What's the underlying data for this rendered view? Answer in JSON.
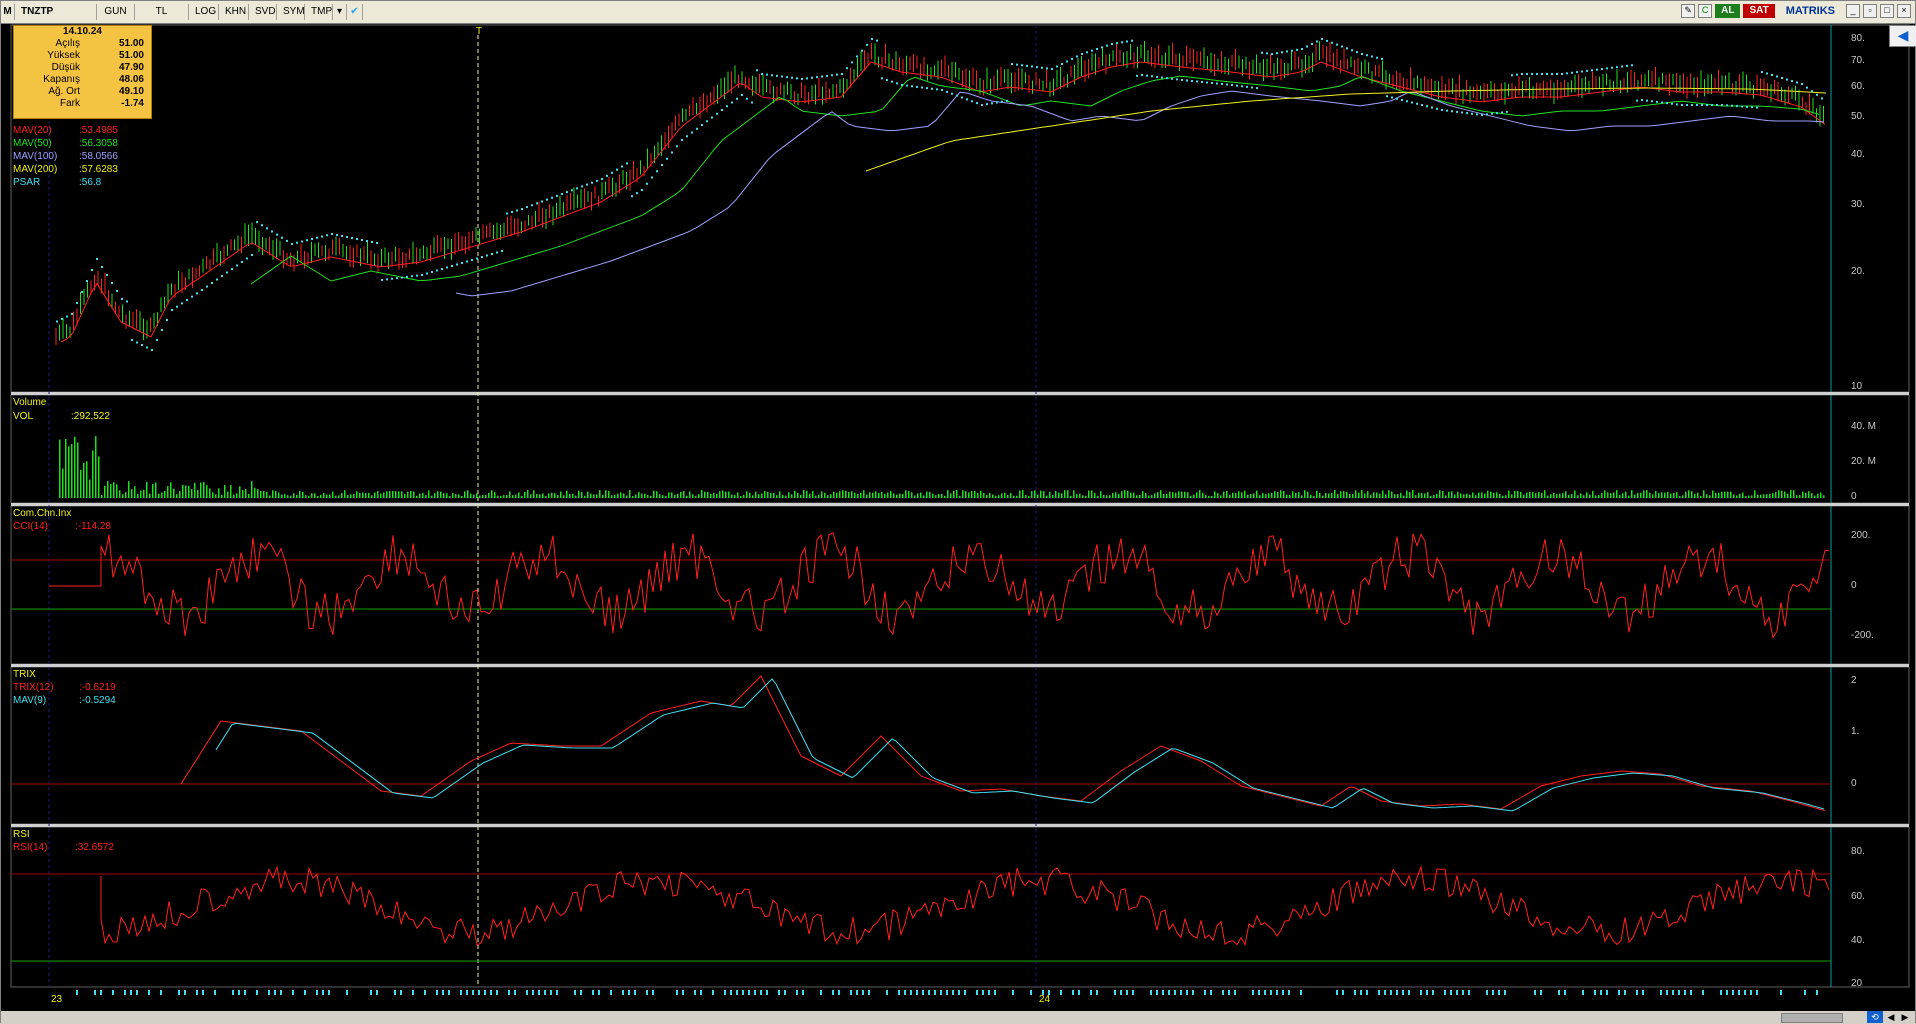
{
  "toolbar": {
    "symbol": "TNZTP",
    "items": [
      "GUN",
      "TL",
      "LOG",
      "KHN",
      "SVD",
      "SYM",
      "TMP"
    ],
    "buy_label": "AL",
    "sell_label": "SAT",
    "brand": "MATRIKS"
  },
  "info": {
    "date": "14.10.24",
    "rows": [
      {
        "label": "Açılış",
        "value": "51.00"
      },
      {
        "label": "Yüksek",
        "value": "51.00"
      },
      {
        "label": "Düşük",
        "value": "47.90"
      },
      {
        "label": "Kapanış",
        "value": "48.06"
      },
      {
        "label": "Ağ. Ort",
        "value": "49.10"
      },
      {
        "label": "Fark",
        "value": "-1.74"
      }
    ]
  },
  "price_indicators": [
    {
      "name": "MAV(20)",
      "value": ":53.4985",
      "color": "#ff2020"
    },
    {
      "name": "MAV(50)",
      "value": ":56.3058",
      "color": "#20e020"
    },
    {
      "name": "MAV(100)",
      "value": ":58.0566",
      "color": "#a0a0ff"
    },
    {
      "name": "MAV(200)",
      "value": ":57.6283",
      "color": "#f0f020"
    },
    {
      "name": "PSAR",
      "value": ":56.8",
      "color": "#40e0f0"
    }
  ],
  "price_axis": [
    "80.",
    "70.",
    "60.",
    "50.",
    "40.",
    "30.",
    "20.",
    "10"
  ],
  "volume": {
    "title": "Volume",
    "name": "VOL",
    "value": ":292,522",
    "axis": [
      "40. M",
      "20. M",
      "0"
    ]
  },
  "cci": {
    "title": "Com.Chn.Inx",
    "name": "CCI(14)",
    "value": ":-114.28",
    "axis": [
      "200.",
      "0",
      "-200."
    ]
  },
  "trix": {
    "title": "TRIX",
    "name": "TRIX(12)",
    "value": ":-0.6219",
    "name2": "MAV(9)",
    "value2": ":-0.5294",
    "axis": [
      "2",
      "1.",
      "0"
    ]
  },
  "rsi": {
    "title": "RSI",
    "name": "RSI(14)",
    "value": ":32.6572",
    "axis": [
      "80.",
      "60.",
      "40.",
      "20"
    ]
  },
  "time_axis": [
    "23",
    "24"
  ],
  "cursor_marker": "T",
  "colors": {
    "red": "#ff2020",
    "green": "#20e020",
    "cyan": "#40e0f0",
    "yellow": "#f0f020",
    "lavender": "#a0a0ff",
    "grid": "#1a1a80"
  }
}
